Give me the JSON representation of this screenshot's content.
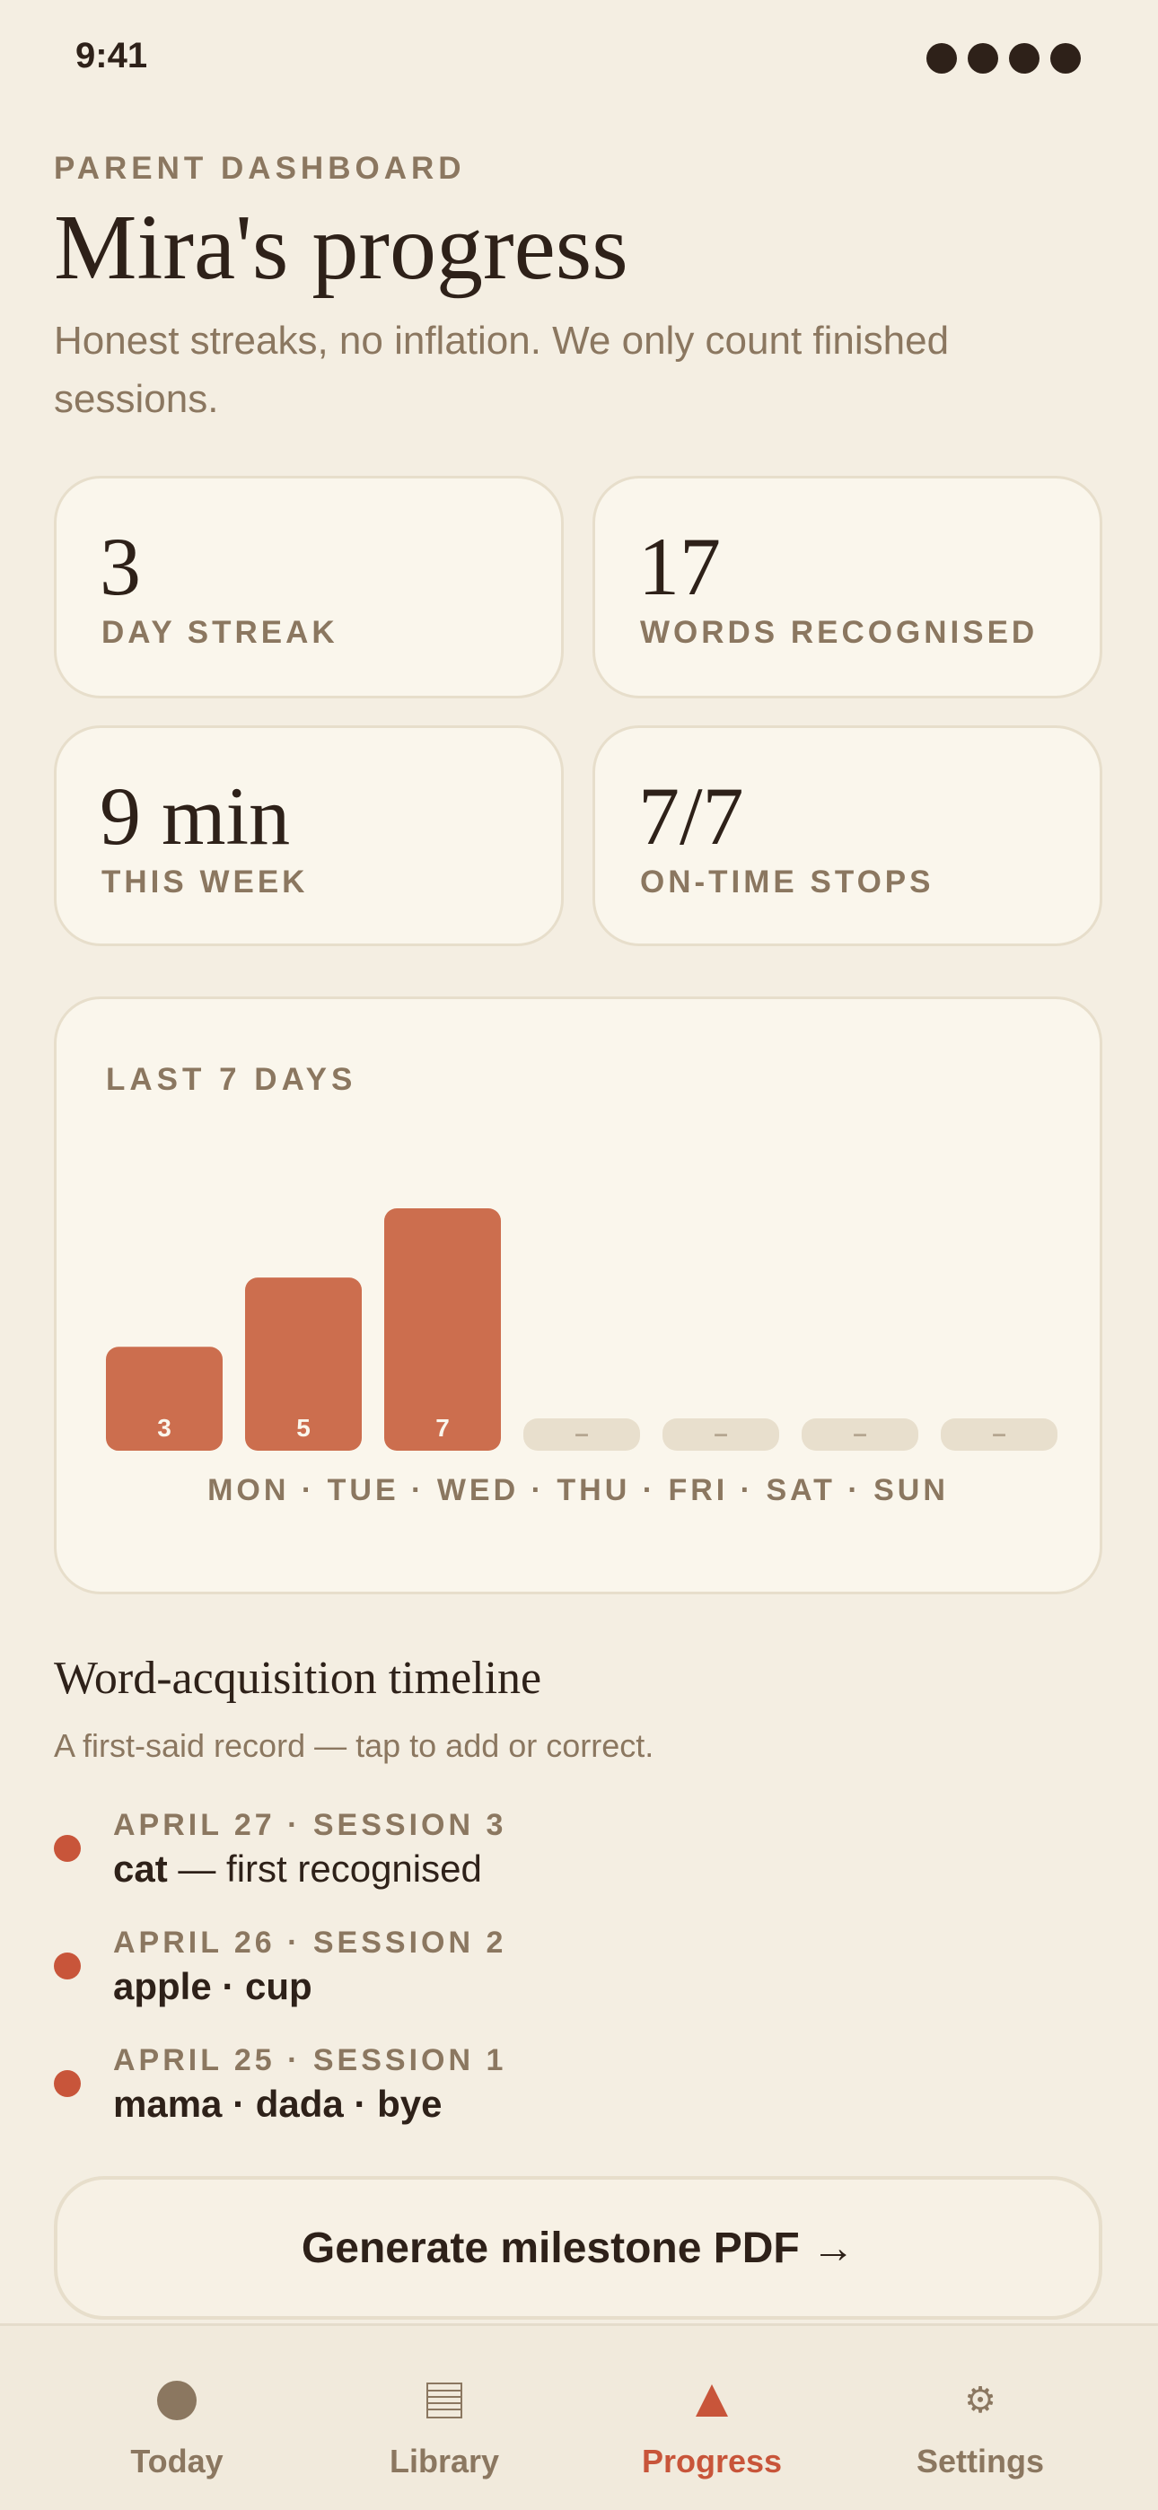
{
  "status_bar": {
    "time": "9:41"
  },
  "header": {
    "eyebrow": "PARENT DASHBOARD",
    "title": "Mira's progress",
    "subtitle": "Honest streaks, no inflation. We only count finished sessions."
  },
  "stats": [
    {
      "value": "3",
      "label": "DAY STREAK"
    },
    {
      "value": "17",
      "label": "WORDS RECOGNISED"
    },
    {
      "value": "9 min",
      "label": "THIS WEEK"
    },
    {
      "value": "7/7",
      "label": "ON-TIME STOPS"
    }
  ],
  "chart": {
    "title": "LAST 7 DAYS",
    "day_labels": "MON · TUE · WED · THU · FRI · SAT · SUN"
  },
  "chart_data": {
    "type": "bar",
    "categories": [
      "MON",
      "TUE",
      "WED",
      "THU",
      "FRI",
      "SAT",
      "SUN"
    ],
    "values": [
      3,
      5,
      7,
      null,
      null,
      null,
      null
    ],
    "value_labels": [
      "3",
      "5",
      "7",
      "–",
      "–",
      "–",
      "–"
    ],
    "title": "LAST 7 DAYS",
    "colors": {
      "active": "#cc6e4e",
      "empty": "#e8dfcd",
      "label": "#faf6ec",
      "empty_label": "#b5a691"
    }
  },
  "timeline": {
    "title": "Word-acquisition timeline",
    "subtitle": "A first-said record — tap to add or correct.",
    "items": [
      {
        "date": "APRIL 27 · SESSION 3",
        "words": "cat",
        "note": " — first recognised"
      },
      {
        "date": "APRIL 26 · SESSION 2",
        "words": "apple · cup",
        "note": ""
      },
      {
        "date": "APRIL 25 · SESSION 1",
        "words": "mama · dada · bye",
        "note": ""
      }
    ]
  },
  "pdf_button": {
    "label": "Generate milestone PDF →"
  },
  "tabs": [
    {
      "label": "Today",
      "icon": "circle-icon"
    },
    {
      "label": "Library",
      "icon": "library-icon"
    },
    {
      "label": "Progress",
      "icon": "triangle-icon",
      "active": true
    },
    {
      "label": "Settings",
      "icon": "gear-icon"
    }
  ],
  "colors": {
    "accent": "#c8553a",
    "background": "#f4eee2",
    "card": "#faf6ec",
    "text": "#2e2119",
    "muted": "#8b7760"
  }
}
